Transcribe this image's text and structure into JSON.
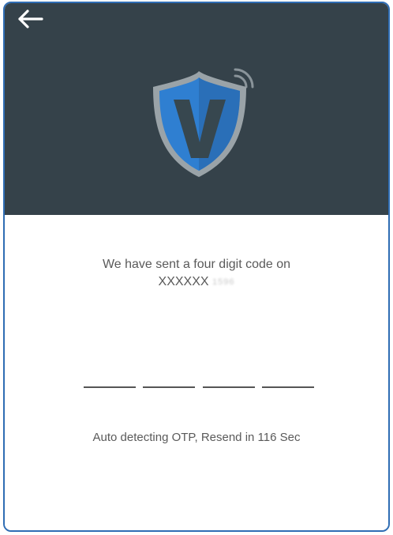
{
  "header": {
    "back_icon": "arrow-left-icon",
    "logo_icon": "shield-v-wireless-icon",
    "background_color": "#35424a"
  },
  "message": {
    "line1": "We have sent a four digit code on",
    "phone_mask": "XXXXXX",
    "phone_suffix_blurred": "1596"
  },
  "otp": {
    "slot_count": 4,
    "values": [
      "",
      "",
      "",
      ""
    ]
  },
  "status": {
    "prefix": "Auto detecting OTP, Resend in ",
    "seconds": "116",
    "suffix": " Sec"
  },
  "colors": {
    "frame_border": "#2f6db4",
    "shield_blue": "#2f7fd1",
    "shield_dark": "#37474f",
    "text": "#5a5a5a"
  }
}
